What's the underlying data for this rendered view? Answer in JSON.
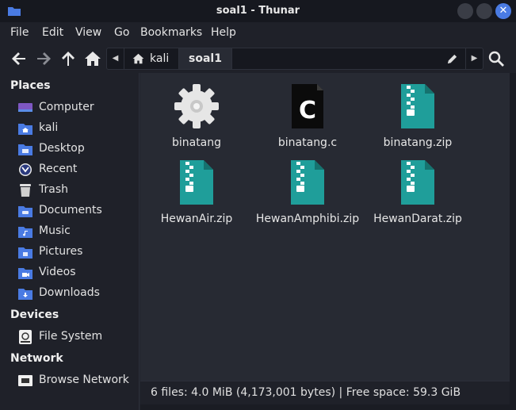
{
  "window": {
    "title": "soal1 - Thunar"
  },
  "menu": [
    "File",
    "Edit",
    "View",
    "Go",
    "Bookmarks",
    "Help"
  ],
  "toolbar": {
    "back_icon": "arrow-left-icon",
    "forward_icon": "arrow-right-icon",
    "up_icon": "arrow-up-icon",
    "home_icon": "home-icon",
    "search_icon": "search-icon"
  },
  "path": {
    "home_crumb": "kali",
    "current_crumb": "soal1"
  },
  "sidebar": {
    "places_title": "Places",
    "places": [
      {
        "label": "Computer",
        "icon": "computer-icon"
      },
      {
        "label": "kali",
        "icon": "home-folder-icon"
      },
      {
        "label": "Desktop",
        "icon": "desktop-folder-icon"
      },
      {
        "label": "Recent",
        "icon": "recent-icon"
      },
      {
        "label": "Trash",
        "icon": "trash-icon"
      },
      {
        "label": "Documents",
        "icon": "documents-folder-icon"
      },
      {
        "label": "Music",
        "icon": "music-folder-icon"
      },
      {
        "label": "Pictures",
        "icon": "pictures-folder-icon"
      },
      {
        "label": "Videos",
        "icon": "videos-folder-icon"
      },
      {
        "label": "Downloads",
        "icon": "downloads-folder-icon"
      }
    ],
    "devices_title": "Devices",
    "devices": [
      {
        "label": "File System",
        "icon": "drive-icon"
      }
    ],
    "network_title": "Network",
    "network": [
      {
        "label": "Browse Network",
        "icon": "network-icon"
      }
    ]
  },
  "files": [
    {
      "name": "binatang",
      "icon": "gear-icon"
    },
    {
      "name": "binatang.c",
      "icon": "c-source-icon"
    },
    {
      "name": "binatang.zip",
      "icon": "zip-icon"
    },
    {
      "name": "HewanAir.zip",
      "icon": "zip-icon"
    },
    {
      "name": "HewanAmphibi.zip",
      "icon": "zip-icon"
    },
    {
      "name": "HewanDarat.zip",
      "icon": "zip-icon"
    }
  ],
  "status": {
    "text": "6 files: 4.0 MiB (4,173,001 bytes) | Free space: 59.3 GiB"
  },
  "colors": {
    "accent": "#4a7be3",
    "zip": "#1f9e9a",
    "folder": "#4a7be3"
  }
}
